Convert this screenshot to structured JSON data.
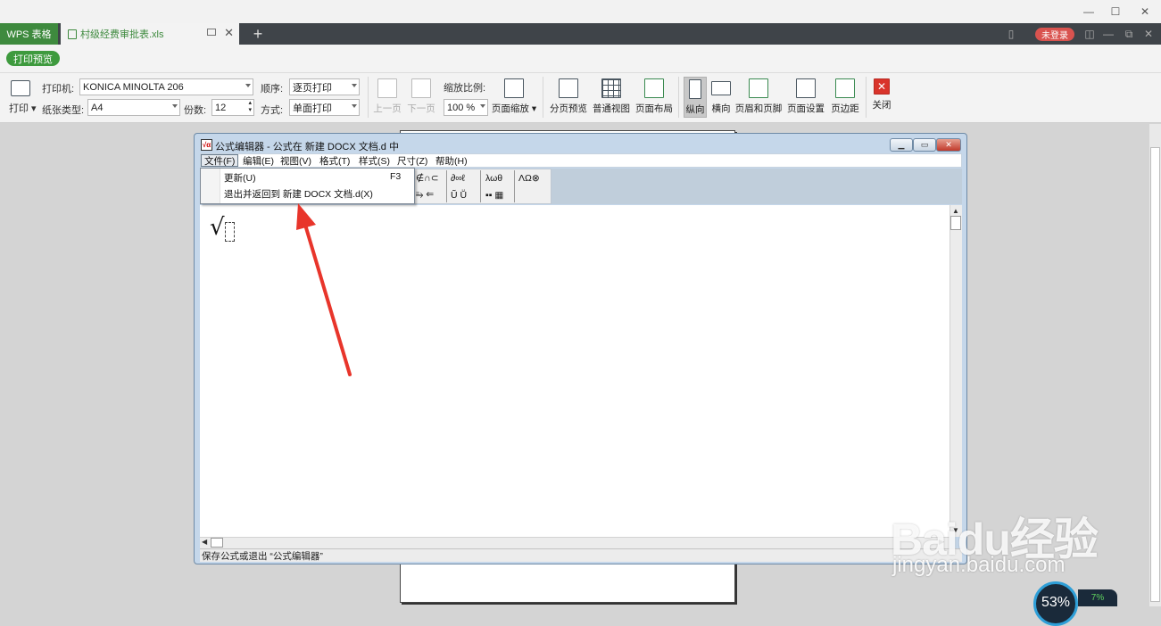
{
  "app_tab": "WPS 表格",
  "doc_tab": "村级经费审批表.xls",
  "login_button": "未登录",
  "preview_button": "打印预览",
  "toolbar": {
    "print_label": "打印",
    "printer_label": "打印机:",
    "printer_value": "KONICA MINOLTA 206",
    "paper_label": "纸张类型:",
    "paper_value": "A4",
    "order_label": "顺序:",
    "order_value": "逐页打印",
    "copies_label": "份数:",
    "copies_value": "12",
    "mode_label": "方式:",
    "mode_value": "单面打印",
    "prev_page": "上一页",
    "next_page": "下一页",
    "zoom_label": "缩放比例:",
    "zoom_value": "100 %",
    "page_zoom": "页面缩放",
    "page_break_preview": "分页预览",
    "normal_view": "普通视图",
    "page_layout": "页面布局",
    "portrait": "纵向",
    "landscape": "横向",
    "header_footer": "页眉和页脚",
    "page_setup": "页面设置",
    "margins": "页边距",
    "close": "关闭"
  },
  "equation_editor": {
    "title": "公式编辑器 - 公式在 新建 DOCX 文档.d 中",
    "menus": [
      "文件(F)",
      "编辑(E)",
      "视图(V)",
      "格式(T)",
      "样式(S)",
      "尺寸(Z)",
      "帮助(H)"
    ],
    "palette_row1": [
      "∉∩⊂",
      "∂∞ℓ",
      "λωθ",
      "ΛΩ⊗"
    ],
    "palette_row2": [
      "⥱ ⇐",
      "Ũ Ṻ",
      "▪▪ ▦"
    ],
    "file_menu": {
      "update": "更新(U)",
      "update_shortcut": "F3",
      "exit": "退出并返回到 新建 DOCX 文档.d(X)"
    },
    "status": "保存公式或退出 “公式编辑器”"
  },
  "watermark": {
    "logo": "Baidu经验",
    "url": "jingyan.baidu.com"
  },
  "widget": {
    "percent": "53%",
    "small": "7%"
  }
}
